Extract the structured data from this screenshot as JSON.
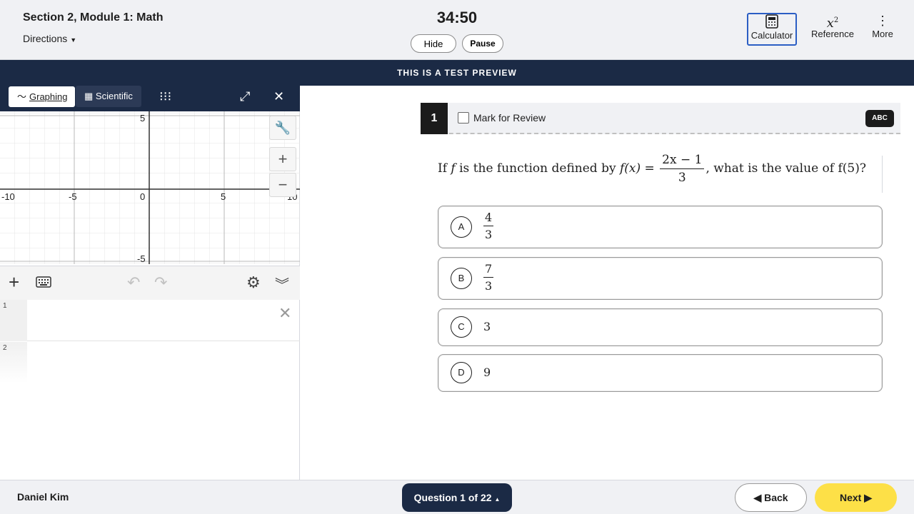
{
  "header": {
    "section_title": "Section 2, Module 1: Math",
    "directions": "Directions",
    "timer": "34:50",
    "hide": "Hide",
    "pause": "Pause",
    "tools": [
      {
        "label": "Calculator",
        "icon": "calculator-icon"
      },
      {
        "label": "Reference",
        "icon": "x-squared-icon"
      },
      {
        "label": "More",
        "icon": "vertical-dots-icon"
      }
    ]
  },
  "banner": "THIS IS A TEST PREVIEW",
  "calculator": {
    "tab_graphing": "Graphing",
    "tab_scientific": "Scientific",
    "graph_axes": {
      "x_ticks": [
        "-10",
        "-5",
        "0",
        "5",
        "10"
      ],
      "y_ticks": [
        "5",
        "-5"
      ]
    },
    "expression_rows": [
      "1",
      "2"
    ]
  },
  "question": {
    "number": "1",
    "mark_for_review": "Mark for Review",
    "abc": "ABC",
    "text_pre": "If ",
    "var_f": "f",
    "text_mid": " is the function defined by ",
    "fx": "f(x) =",
    "frac_num": "2x − 1",
    "frac_den": "3",
    "text_post": ", what is the value of f(5)?",
    "options": [
      {
        "letter": "A",
        "num": "4",
        "den": "3"
      },
      {
        "letter": "B",
        "num": "7",
        "den": "3"
      },
      {
        "letter": "C",
        "value": "3"
      },
      {
        "letter": "D",
        "value": "9"
      }
    ]
  },
  "footer": {
    "student": "Daniel Kim",
    "question_nav": "Question 1 of 22",
    "back": "Back",
    "next": "Next"
  }
}
